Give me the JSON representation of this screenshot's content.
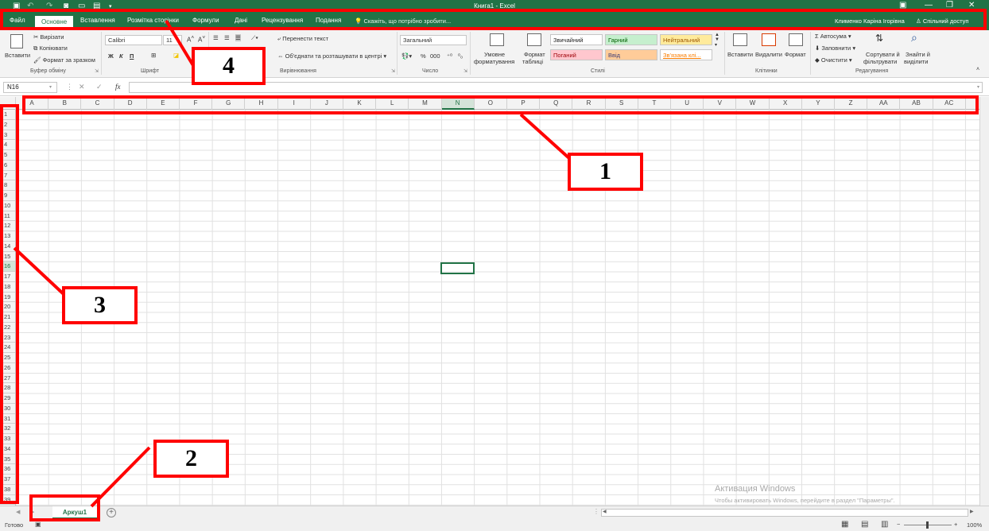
{
  "titlebar": {
    "title": "Книга1 - Excel",
    "bg": "#217346"
  },
  "tabs": [
    {
      "label": "Файл"
    },
    {
      "label": "Основне",
      "active": true
    },
    {
      "label": "Вставлення"
    },
    {
      "label": "Розмітка сторінки"
    },
    {
      "label": "Формули"
    },
    {
      "label": "Дані"
    },
    {
      "label": "Рецензування"
    },
    {
      "label": "Подання"
    }
  ],
  "tell_me": "Скажіть, що потрібно зробити...",
  "user_name": "Клименко Каріна Ігорівна",
  "share_label": "Спільний доступ",
  "ribbon": {
    "clipboard": {
      "paste": "Вставити",
      "cut": "Вирізати",
      "copy": "Копіювати",
      "format_painter": "Формат за зразком",
      "group": "Буфер обміну"
    },
    "font": {
      "name": "Calibri",
      "size": "11",
      "bold": "Ж",
      "italic": "К",
      "underline": "П",
      "group": "Шрифт"
    },
    "alignment": {
      "wrap": "Перенести текст",
      "merge": "Об'єднати та розташувати в центрі",
      "group": "Вирівнювання"
    },
    "number": {
      "format": "Загальний",
      "percent": "%",
      "thousands": "000",
      "group": "Число"
    },
    "styles": {
      "cond_format_1": "Умовне",
      "cond_format_2": "форматування",
      "table_format_1": "Формат",
      "table_format_2": "таблиці",
      "normal": "Звичайний",
      "good": "Гарний",
      "neutral": "Нейтральний",
      "bad": "Поганий",
      "input": "Ввід",
      "linked": "Зв'язана клі...",
      "group": "Стилі"
    },
    "cells": {
      "insert": "Вставити",
      "delete": "Видалити",
      "format": "Формат",
      "group": "Клітинки"
    },
    "editing": {
      "autosum": "Автосума",
      "fill": "Заповнити",
      "clear": "Очистити",
      "sort_1": "Сортувати й",
      "sort_2": "фільтрувати",
      "find_1": "Знайти й",
      "find_2": "виділити",
      "group": "Редагування"
    }
  },
  "formula_bar": {
    "name_box": "N16",
    "fx": "fx",
    "cancel": "✕",
    "enter": "✓"
  },
  "columns": [
    "A",
    "B",
    "C",
    "D",
    "E",
    "F",
    "G",
    "H",
    "I",
    "J",
    "K",
    "L",
    "M",
    "N",
    "O",
    "P",
    "Q",
    "R",
    "S",
    "T",
    "U",
    "V",
    "W",
    "X",
    "Y",
    "Z",
    "AA",
    "AB",
    "AC"
  ],
  "selected_column": "N",
  "rows": [
    "1",
    "2",
    "3",
    "4",
    "5",
    "6",
    "7",
    "8",
    "9",
    "10",
    "11",
    "12",
    "13",
    "14",
    "15",
    "16",
    "17",
    "18",
    "19",
    "20",
    "21",
    "22",
    "23",
    "24",
    "25",
    "26",
    "27",
    "28",
    "29",
    "30",
    "31",
    "32",
    "33",
    "34",
    "35",
    "36",
    "37",
    "38",
    "39"
  ],
  "selected_row": "16",
  "sheet_tab": "Аркуш1",
  "status": {
    "ready": "Готово",
    "zoom": "100%"
  },
  "watermark": {
    "line1": "Активация Windows",
    "line2": "Чтобы активировать Windows, перейдите в раздел \"Параметры\"."
  },
  "annotations": [
    {
      "label": "1"
    },
    {
      "label": "2"
    },
    {
      "label": "3"
    },
    {
      "label": "4"
    }
  ],
  "colors": {
    "accent": "#217346",
    "annotation": "#ff0000"
  }
}
